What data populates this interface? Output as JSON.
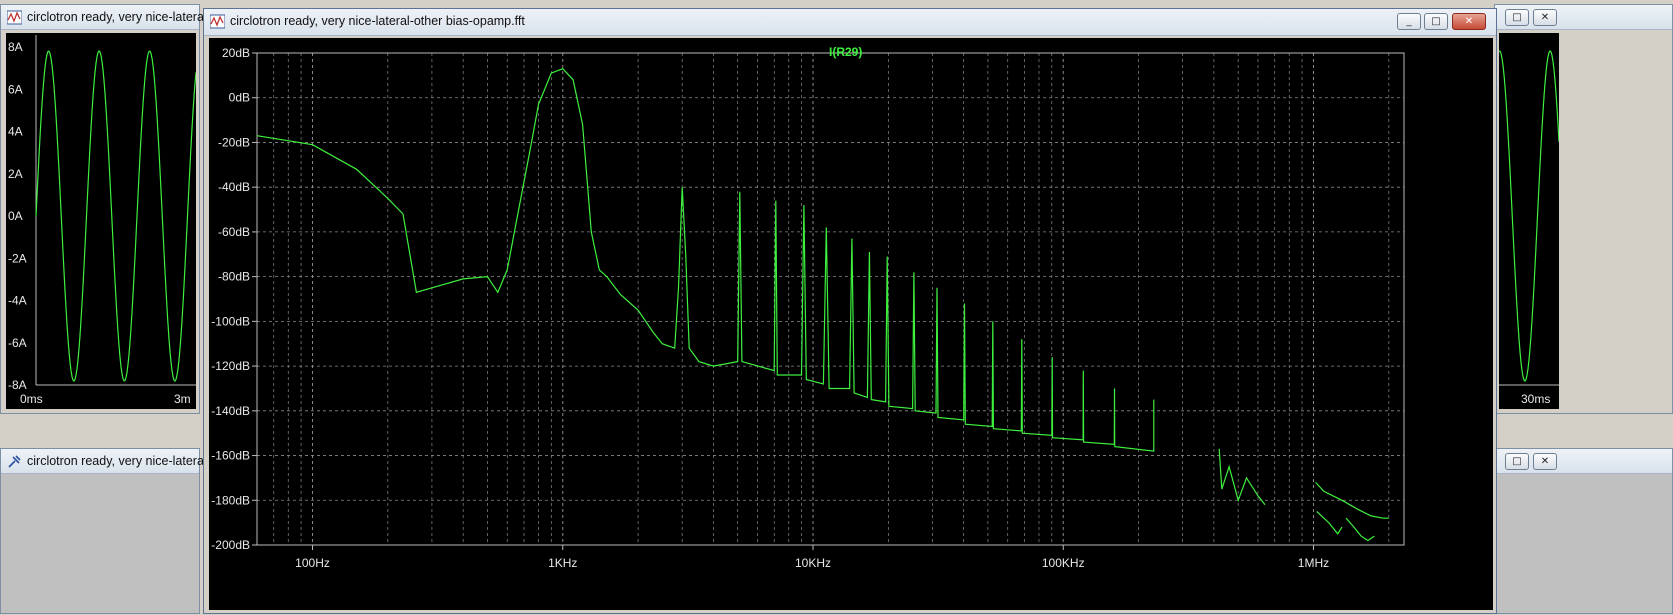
{
  "windows": {
    "transient": {
      "title": "circlotron ready, very nice-lateral",
      "y_ticks": [
        "8A",
        "6A",
        "4A",
        "2A",
        "0A",
        "-2A",
        "-4A",
        "-6A",
        "-8A"
      ],
      "x_ticks": [
        "0ms",
        "3m"
      ],
      "right_x_tick": "30ms"
    },
    "lower": {
      "title": "circlotron ready, very nice-lateral"
    },
    "fft": {
      "title": "circlotron ready, very nice-lateral-other bias-opamp.fft",
      "minimize": "_",
      "maximize": "□",
      "close": "✕"
    }
  },
  "colors": {
    "trace": "#3ef03e",
    "grid": "#8a8a8a",
    "background": "#000000"
  },
  "chart_data": {
    "type": "line",
    "title": "I(R29)",
    "x_scale": "log",
    "xlim": [
      60,
      2300000
    ],
    "ylim": [
      -200,
      20
    ],
    "x_ticks": [
      {
        "value": 100,
        "label": "100Hz"
      },
      {
        "value": 1000,
        "label": "1KHz"
      },
      {
        "value": 10000,
        "label": "10KHz"
      },
      {
        "value": 100000,
        "label": "100KHz"
      },
      {
        "value": 1000000,
        "label": "1MHz"
      }
    ],
    "y_ticks": [
      20,
      0,
      -20,
      -40,
      -60,
      -80,
      -100,
      -120,
      -140,
      -160,
      -180,
      -200
    ],
    "y_tick_labels": [
      "20dB",
      "0dB",
      "-20dB",
      "-40dB",
      "-60dB",
      "-80dB",
      "-100dB",
      "-120dB",
      "-140dB",
      "-160dB",
      "-180dB",
      "-200dB"
    ],
    "grid": true,
    "series": [
      {
        "points": [
          [
            60,
            -17
          ],
          [
            100,
            -21
          ],
          [
            150,
            -32
          ],
          [
            200,
            -45
          ],
          [
            230,
            -52
          ],
          [
            260,
            -87
          ],
          [
            300,
            -85
          ],
          [
            400,
            -81
          ],
          [
            500,
            -80
          ],
          [
            550,
            -87
          ],
          [
            600,
            -77
          ],
          [
            680,
            -45
          ],
          [
            750,
            -20
          ],
          [
            800,
            -3
          ],
          [
            900,
            11
          ],
          [
            1000,
            13
          ],
          [
            1100,
            8
          ],
          [
            1200,
            -12
          ],
          [
            1300,
            -60
          ],
          [
            1400,
            -77
          ],
          [
            1500,
            -80
          ],
          [
            1700,
            -88
          ],
          [
            2000,
            -95
          ],
          [
            2300,
            -105
          ],
          [
            2500,
            -110
          ],
          [
            2800,
            -112
          ],
          [
            2900,
            -85
          ],
          [
            3000,
            -40
          ],
          [
            3100,
            -70
          ],
          [
            3200,
            -112
          ],
          [
            3500,
            -118
          ],
          [
            4000,
            -120
          ],
          [
            5000,
            -118
          ],
          [
            5100,
            -42
          ],
          [
            5200,
            -118
          ],
          [
            7000,
            -122
          ],
          [
            7100,
            -46
          ],
          [
            7200,
            -124
          ],
          [
            9000,
            -124
          ],
          [
            9200,
            -48
          ],
          [
            9400,
            -126
          ],
          [
            11000,
            -128
          ],
          [
            11300,
            -58
          ],
          [
            11600,
            -130
          ],
          [
            14000,
            -130
          ],
          [
            14300,
            -63
          ],
          [
            14600,
            -132
          ],
          [
            16500,
            -134
          ],
          [
            16800,
            -69
          ],
          [
            17100,
            -135
          ],
          [
            19500,
            -136
          ],
          [
            19800,
            -71
          ],
          [
            20100,
            -138
          ],
          [
            25000,
            -139
          ],
          [
            25300,
            -78
          ],
          [
            25600,
            -140
          ],
          [
            31000,
            -141
          ],
          [
            31300,
            -85
          ],
          [
            31600,
            -143
          ],
          [
            40000,
            -144
          ],
          [
            40300,
            -92
          ],
          [
            40600,
            -146
          ],
          [
            52000,
            -147
          ],
          [
            52300,
            -100
          ],
          [
            52600,
            -148
          ],
          [
            68000,
            -149
          ],
          [
            68300,
            -108
          ],
          [
            68600,
            -150
          ],
          [
            90000,
            -151
          ],
          [
            90300,
            -116
          ],
          [
            90600,
            -152
          ],
          [
            120000,
            -153
          ],
          [
            120300,
            -122
          ],
          [
            120600,
            -154
          ],
          [
            160000,
            -155
          ],
          [
            160300,
            -130
          ],
          [
            160600,
            -156
          ],
          [
            230000,
            -158
          ],
          [
            230000,
            -135
          ],
          [
            230000,
            -158
          ]
        ]
      },
      {
        "points": [
          [
            420000,
            -157
          ],
          [
            430000,
            -175
          ],
          [
            460000,
            -165
          ],
          [
            500000,
            -180
          ],
          [
            540000,
            -170
          ],
          [
            600000,
            -178
          ],
          [
            640000,
            -182
          ]
        ]
      },
      {
        "points": [
          [
            1020000,
            -172
          ],
          [
            1100000,
            -176
          ],
          [
            1300000,
            -180
          ],
          [
            1500000,
            -184
          ],
          [
            1700000,
            -187
          ],
          [
            1900000,
            -188
          ],
          [
            2000000,
            -188
          ]
        ]
      },
      {
        "points": [
          [
            1030000,
            -185
          ],
          [
            1150000,
            -190
          ],
          [
            1250000,
            -195
          ],
          [
            1300000,
            -192
          ]
        ]
      },
      {
        "points": [
          [
            1350000,
            -188
          ],
          [
            1450000,
            -192
          ],
          [
            1550000,
            -196
          ],
          [
            1650000,
            -198
          ],
          [
            1750000,
            -196
          ]
        ]
      }
    ]
  }
}
